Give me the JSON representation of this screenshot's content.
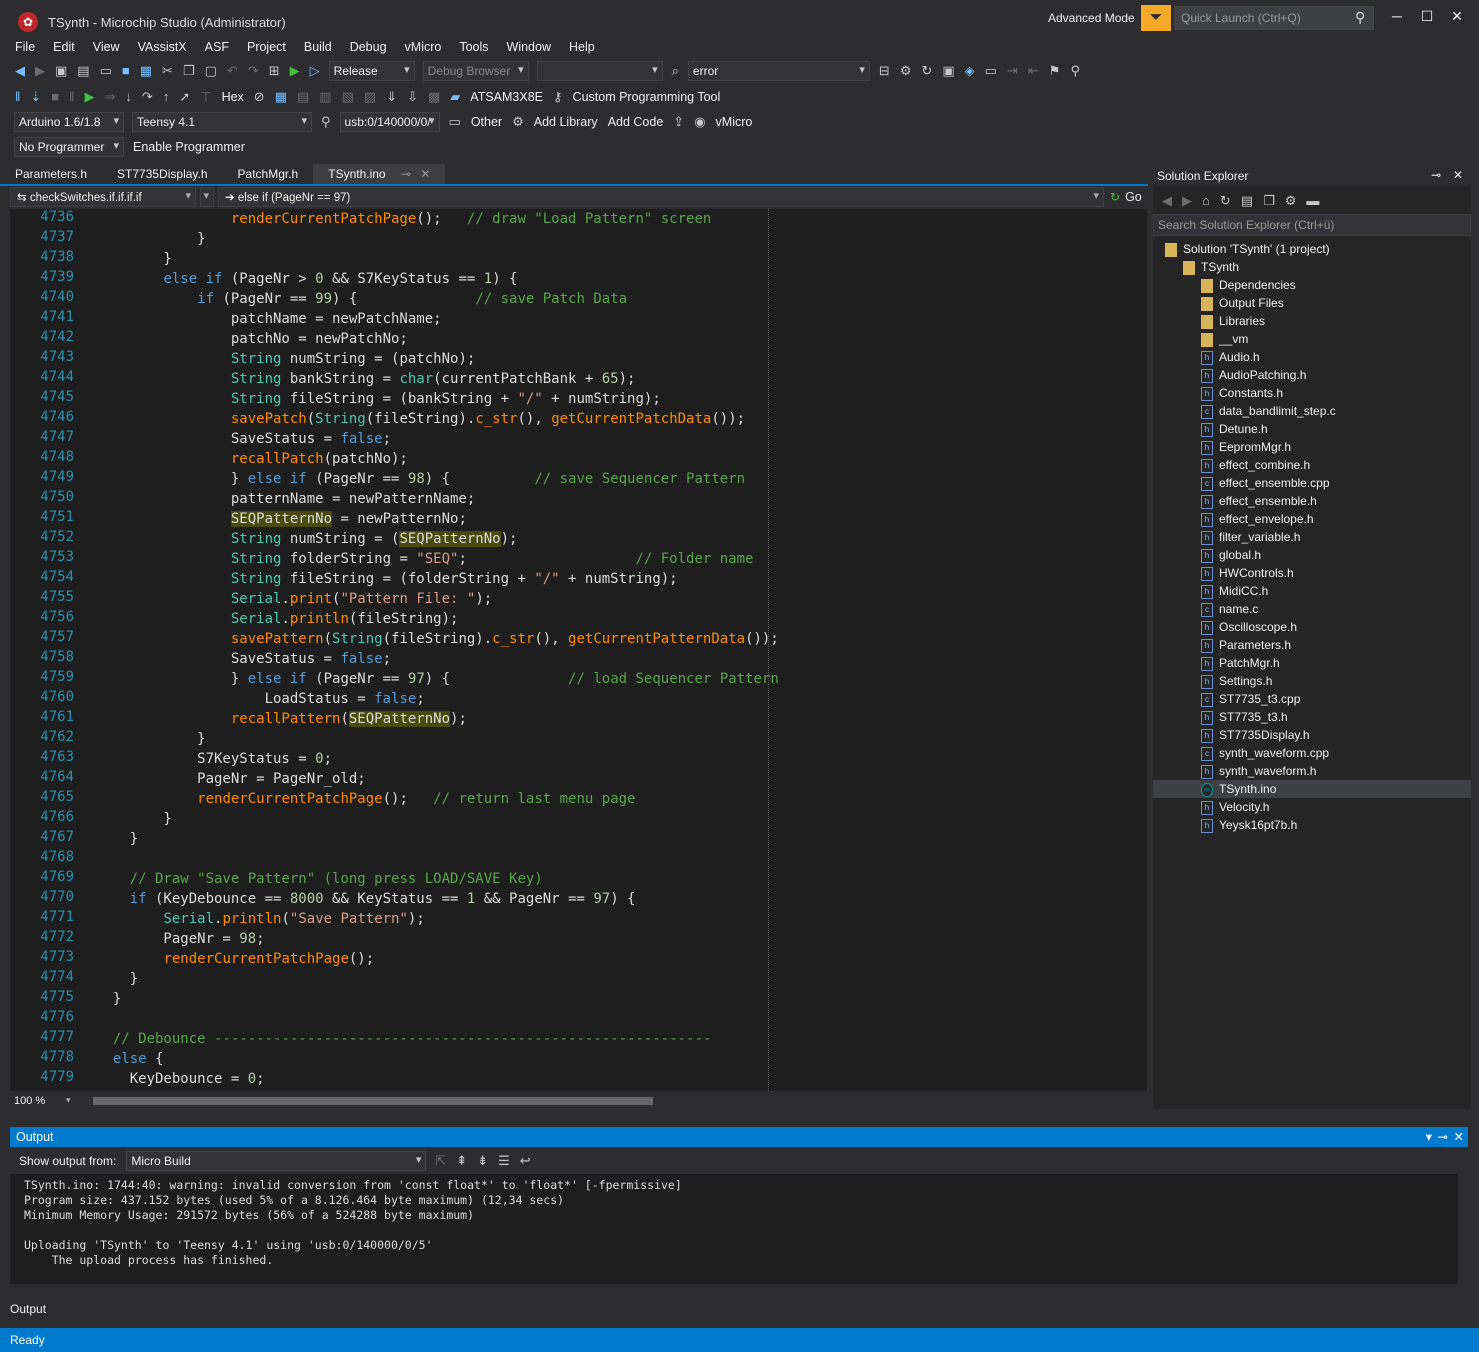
{
  "window": {
    "title": "TSynth - Microchip Studio (Administrator)",
    "advanced_mode": "Advanced Mode",
    "quick_launch_placeholder": "Quick Launch (Ctrl+Q)"
  },
  "menu": [
    "File",
    "Edit",
    "View",
    "VAssistX",
    "ASF",
    "Project",
    "Build",
    "Debug",
    "vMicro",
    "Tools",
    "Window",
    "Help"
  ],
  "toolbar1": {
    "config": "Release",
    "debug_browser": "Debug Browser",
    "search_value": "error"
  },
  "toolbar2": {
    "hex_label": "Hex",
    "device": "ATSAM3X8E",
    "custom_tool": "Custom Programming Tool"
  },
  "toolbar3": {
    "platform": "Arduino 1.6/1.8",
    "board": "Teensy 4.1",
    "port": "usb:0/140000/0/",
    "other": "Other",
    "add_library": "Add Library",
    "add_code": "Add Code",
    "vmicro": "vMicro"
  },
  "toolbar4": {
    "programmer": "No Programmer",
    "enable_programmer": "Enable Programmer"
  },
  "tabs": [
    "Parameters.h",
    "ST7735Display.h",
    "PatchMgr.h",
    "TSynth.ino"
  ],
  "active_tab": "TSynth.ino",
  "nav": {
    "scope": "checkSwitches.if.if.if.if",
    "member": "else if (PageNr == 97)",
    "go": "Go"
  },
  "editor": {
    "zoom": "100 %",
    "line_numbers": [
      "4736",
      "4737",
      "4738",
      "4739",
      "4740",
      "4741",
      "4742",
      "4743",
      "4744",
      "4745",
      "4746",
      "4747",
      "4748",
      "4749",
      "4750",
      "4751",
      "4752",
      "4753",
      "4754",
      "4755",
      "4756",
      "4757",
      "4758",
      "4759",
      "4760",
      "4761",
      "4762",
      "4763",
      "4764",
      "4765",
      "4766",
      "4767",
      "4768",
      "4769",
      "4770",
      "4771",
      "4772",
      "4773",
      "4774",
      "4775",
      "4776",
      "4777",
      "4778",
      "4779"
    ],
    "code_lines": [
      "                renderCurrentPatchPage();   // draw \"Load Pattern\" screen",
      "            }",
      "        }",
      "        else if (PageNr > 0 && S7KeyStatus == 1) {",
      "            if (PageNr == 99) {              // save Patch Data",
      "                patchName = newPatchName;",
      "                patchNo = newPatchNo;",
      "                String numString = (patchNo);",
      "                String bankString = char(currentPatchBank + 65);",
      "                String fileString = (bankString + \"/\" + numString);",
      "                savePatch(String(fileString).c_str(), getCurrentPatchData());",
      "                SaveStatus = false;",
      "                recallPatch(patchNo);",
      "                } else if (PageNr == 98) {          // save Sequencer Pattern",
      "                patternName = newPatternName;",
      "                SEQPatternNo = newPatternNo;",
      "                String numString = (SEQPatternNo);",
      "                String folderString = \"SEQ\";                    // Folder name",
      "                String fileString = (folderString + \"/\" + numString);",
      "                Serial.print(\"Pattern File: \");",
      "                Serial.println(fileString);",
      "                savePattern(String(fileString).c_str(), getCurrentPatternData());",
      "                SaveStatus = false;",
      "                } else if (PageNr == 97) {              // load Sequencer Pattern",
      "                    LoadStatus = false;",
      "                recallPattern(SEQPatternNo);",
      "            }",
      "            S7KeyStatus = 0;",
      "            PageNr = PageNr_old;",
      "            renderCurrentPatchPage();   // return last menu page",
      "        }",
      "    }",
      "",
      "    // Draw \"Save Pattern\" (long press LOAD/SAVE Key)",
      "    if (KeyDebounce == 8000 && KeyStatus == 1 && PageNr == 97) {",
      "        Serial.println(\"Save Pattern\");",
      "        PageNr = 98;",
      "        renderCurrentPatchPage();",
      "    }",
      "  }",
      "",
      "  // Debounce -----------------------------------------------------------",
      "  else {",
      "    KeyDebounce = 0;"
    ]
  },
  "solution_explorer": {
    "title": "Solution Explorer",
    "search_placeholder": "Search Solution Explorer (Ctrl+ü)",
    "solution": "Solution 'TSynth' (1 project)",
    "project": "TSynth",
    "folders": [
      "Dependencies",
      "Output Files",
      "Libraries",
      "__vm"
    ],
    "files": [
      "Audio.h",
      "AudioPatching.h",
      "Constants.h",
      "data_bandlimit_step.c",
      "Detune.h",
      "EepromMgr.h",
      "effect_combine.h",
      "effect_ensemble.cpp",
      "effect_ensemble.h",
      "effect_envelope.h",
      "filter_variable.h",
      "global.h",
      "HWControls.h",
      "MidiCC.h",
      "name.c",
      "Oscilloscope.h",
      "Parameters.h",
      "PatchMgr.h",
      "Settings.h",
      "ST7735_t3.cpp",
      "ST7735_t3.h",
      "ST7735Display.h",
      "synth_waveform.cpp",
      "synth_waveform.h",
      "TSynth.ino",
      "Velocity.h",
      "Yeysk16pt7b.h"
    ],
    "selected": "TSynth.ino"
  },
  "output": {
    "title": "Output",
    "show_from_label": "Show output from:",
    "source": "Micro Build",
    "lines": [
      "TSynth.ino: 1744:40: warning: invalid conversion from 'const float*' to 'float*' [-fpermissive]",
      "Program size: 437.152 bytes (used 5% of a 8.126.464 byte maximum) (12,34 secs)",
      "Minimum Memory Usage: 291572 bytes (56% of a 524288 byte maximum)",
      "",
      "Uploading 'TSynth' to 'Teensy 4.1' using 'usb:0/140000/0/5'",
      "    The upload process has finished."
    ],
    "tab_label": "Output"
  },
  "status": "Ready"
}
